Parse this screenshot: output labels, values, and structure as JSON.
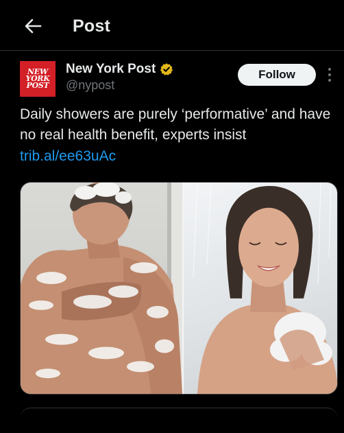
{
  "header": {
    "back_icon": "arrow-left-icon",
    "title": "Post"
  },
  "author": {
    "avatar_lines": [
      "NEW",
      "YORK",
      "POST"
    ],
    "avatar_color": "#d31f26",
    "name": "New York Post",
    "verified_icon": "gold-verified-badge-icon",
    "verified_color": "#e2b719",
    "handle": "@nypost"
  },
  "actions": {
    "follow_label": "Follow",
    "more_icon": "vertical-ellipsis-icon"
  },
  "tweet": {
    "text": "Daily showers are purely ‘performative’ and have no real health benefit, experts insist",
    "link": "trib.al/ee63uAc",
    "link_color": "#1d9bf0"
  },
  "media": {
    "left_photo": "man-showering-with-soap-photo",
    "right_photo": "woman-showering-with-sponge-photo"
  }
}
